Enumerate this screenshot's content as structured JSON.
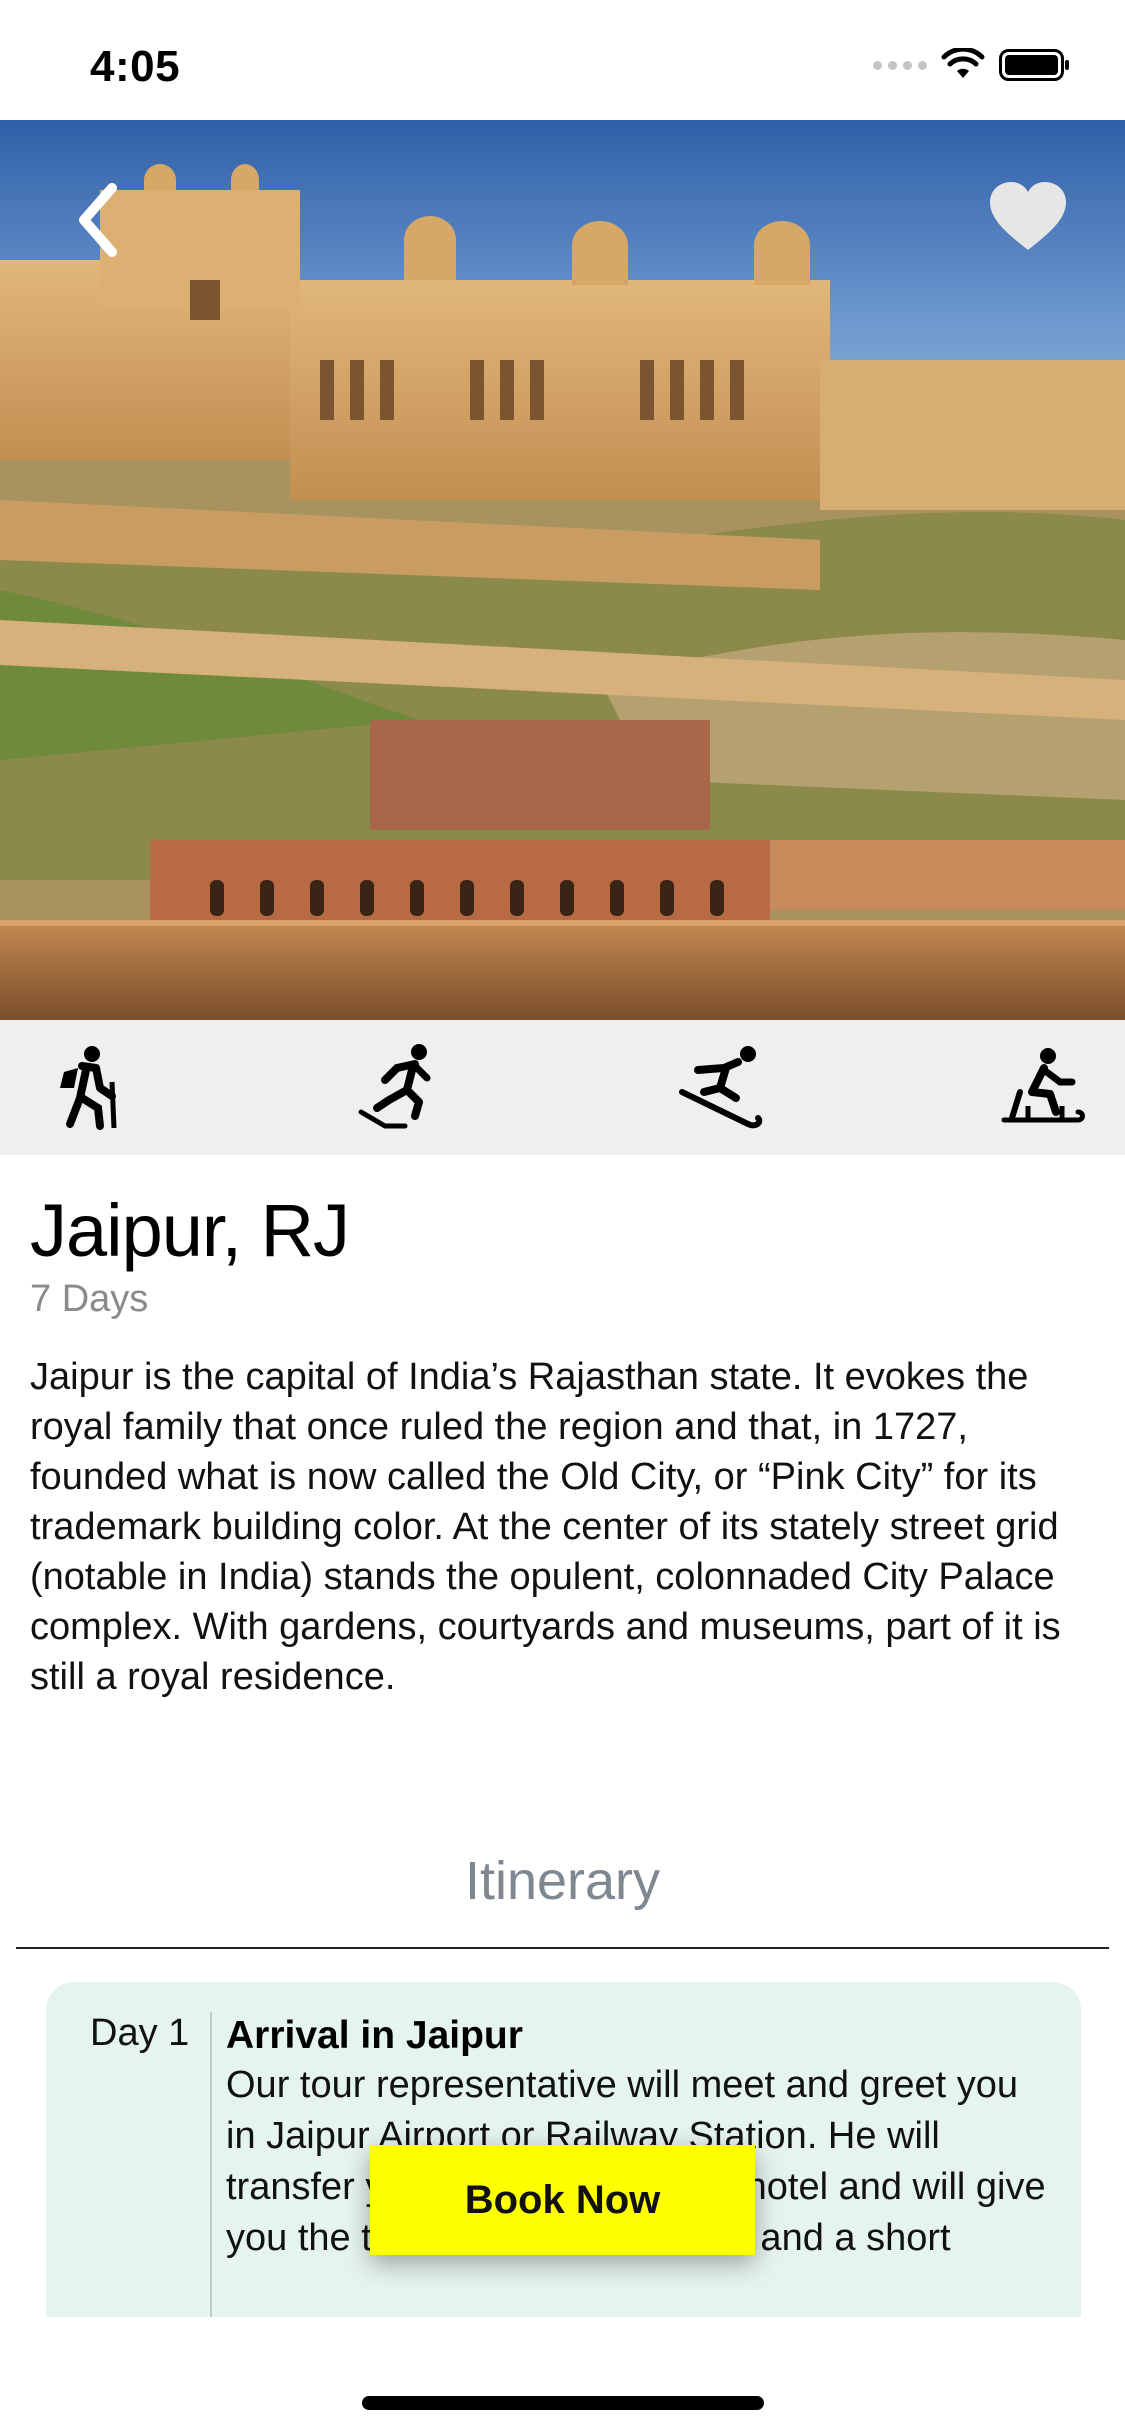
{
  "status_bar": {
    "time": "4:05"
  },
  "hero": {
    "image_alt": "Amber Fort, Jaipur",
    "back_icon": "chevron-left-icon",
    "favorite_icon": "heart-icon"
  },
  "activities": [
    {
      "icon": "hiking-icon"
    },
    {
      "icon": "skating-icon"
    },
    {
      "icon": "snowboarding-icon"
    },
    {
      "icon": "sledding-icon"
    }
  ],
  "destination": {
    "title": "Jaipur, RJ",
    "duration": "7 Days",
    "description": "Jaipur is the capital of India’s Rajasthan state. It evokes the royal family that once ruled the region and that, in 1727, founded what is now called the Old City, or “Pink City” for its trademark building color. At the center of its stately street grid (notable in India) stands the opulent, colonnaded City Palace complex. With gardens, courtyards and museums, part of it is still a royal residence."
  },
  "itinerary": {
    "section_title": "Itinerary",
    "days": [
      {
        "label": "Day 1",
        "title": "Arrival in Jaipur",
        "text": "Our tour representative will meet and greet you in Jaipur Airport or Railway Station. He will transfer you to the pre-booked hotel and will give you the tour related documents and a short"
      }
    ]
  },
  "cta": {
    "book_label": "Book Now"
  },
  "colors": {
    "accent": "#ffff00",
    "card_bg": "#e6f4f1",
    "strip_bg": "#efefef",
    "muted": "#8a8a8a"
  }
}
